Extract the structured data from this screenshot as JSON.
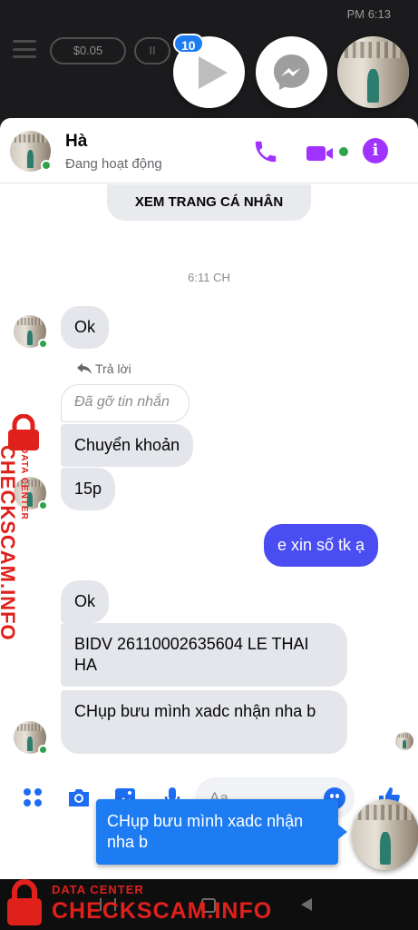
{
  "status_bar": {
    "time": "PM 6:13"
  },
  "background": {
    "coins": "$0.05",
    "pause": "II"
  },
  "chat_heads": {
    "unread_badge": "10"
  },
  "header": {
    "name": "Hà",
    "status": "Đang hoạt động"
  },
  "profile_button": "XEM TRANG CÁ NHÂN",
  "timestamp": "6:11 CH",
  "messages": [
    {
      "text": "Ok"
    },
    {
      "text": "Chuyển khoản"
    },
    {
      "text": "15p"
    },
    {
      "text": "e xin số tk ạ"
    },
    {
      "text": "Ok"
    },
    {
      "text": "BIDV 26110002635604 LE THAI HA"
    },
    {
      "text": "CHụp bưu mình xadc nhận nha b"
    }
  ],
  "reply_label": "Trả lời",
  "unsent_text": "Đã gỡ tin nhắn",
  "composer": {
    "placeholder": "Aa"
  },
  "preview_tooltip": "CHụp bưu mình xadc nhận nha b",
  "watermark": {
    "top": "DATA CENTER",
    "brand": "CHECKSCAM.INFO"
  },
  "colors": {
    "accent": "#a033ff",
    "outgoing_bubble": "#4a4df2",
    "online": "#31a24c",
    "link_blue": "#1e7cf2",
    "watermark": "#e0201a"
  }
}
